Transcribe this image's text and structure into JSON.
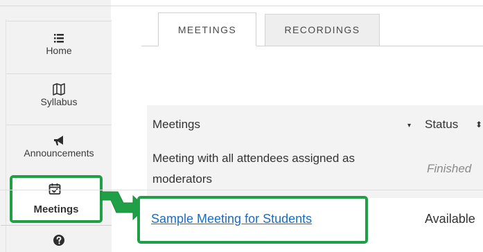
{
  "sidebar": {
    "items": [
      {
        "label": "Home",
        "icon": "list-icon"
      },
      {
        "label": "Syllabus",
        "icon": "map-icon"
      },
      {
        "label": "Announcements",
        "icon": "megaphone-icon"
      },
      {
        "label": "Meetings",
        "icon": "calendar-check-icon"
      },
      {
        "label": "",
        "icon": "help-icon"
      }
    ]
  },
  "tabs": [
    {
      "label": "MEETINGS",
      "active": true
    },
    {
      "label": "RECORDINGS",
      "active": false
    }
  ],
  "table": {
    "columns": [
      "Meetings",
      "Status"
    ],
    "rows": [
      {
        "meeting": "Meeting with all attendees assigned as moderators",
        "status": "Finished"
      },
      {
        "meeting": "Sample Meeting for Students",
        "status": "Available"
      }
    ]
  },
  "colors": {
    "highlight": "#1fa046",
    "link": "#1b6cc4",
    "sidebar_bg": "#f2f2f2"
  }
}
